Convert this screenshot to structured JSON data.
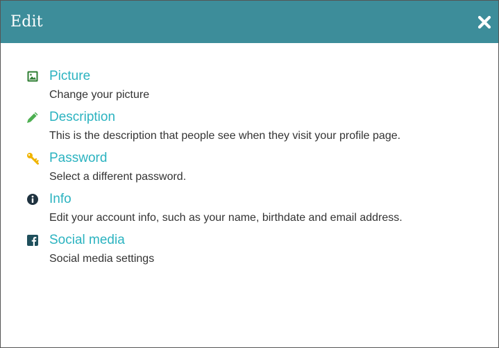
{
  "dialog": {
    "title": "Edit",
    "close_icon": "close-icon",
    "header_color": "#3d8d9a"
  },
  "colors": {
    "link": "#2bb3c0",
    "text": "#333333",
    "picture_icon": "#2e7d32",
    "description_icon": "#4caf50",
    "password_icon": "#f0b400",
    "info_icon": "#1f3340",
    "social_icon": "#1f4f5c"
  },
  "items": [
    {
      "icon": "picture-icon",
      "label": "Picture",
      "description": "Change your picture"
    },
    {
      "icon": "pencil-icon",
      "label": "Description",
      "description": "This is the description that people see when they visit your profile page."
    },
    {
      "icon": "key-icon",
      "label": "Password",
      "description": "Select a different password."
    },
    {
      "icon": "info-icon",
      "label": "Info",
      "description": "Edit your account info, such as your name, birthdate and email address."
    },
    {
      "icon": "facebook-icon",
      "label": "Social media",
      "description": "Social media settings"
    }
  ]
}
